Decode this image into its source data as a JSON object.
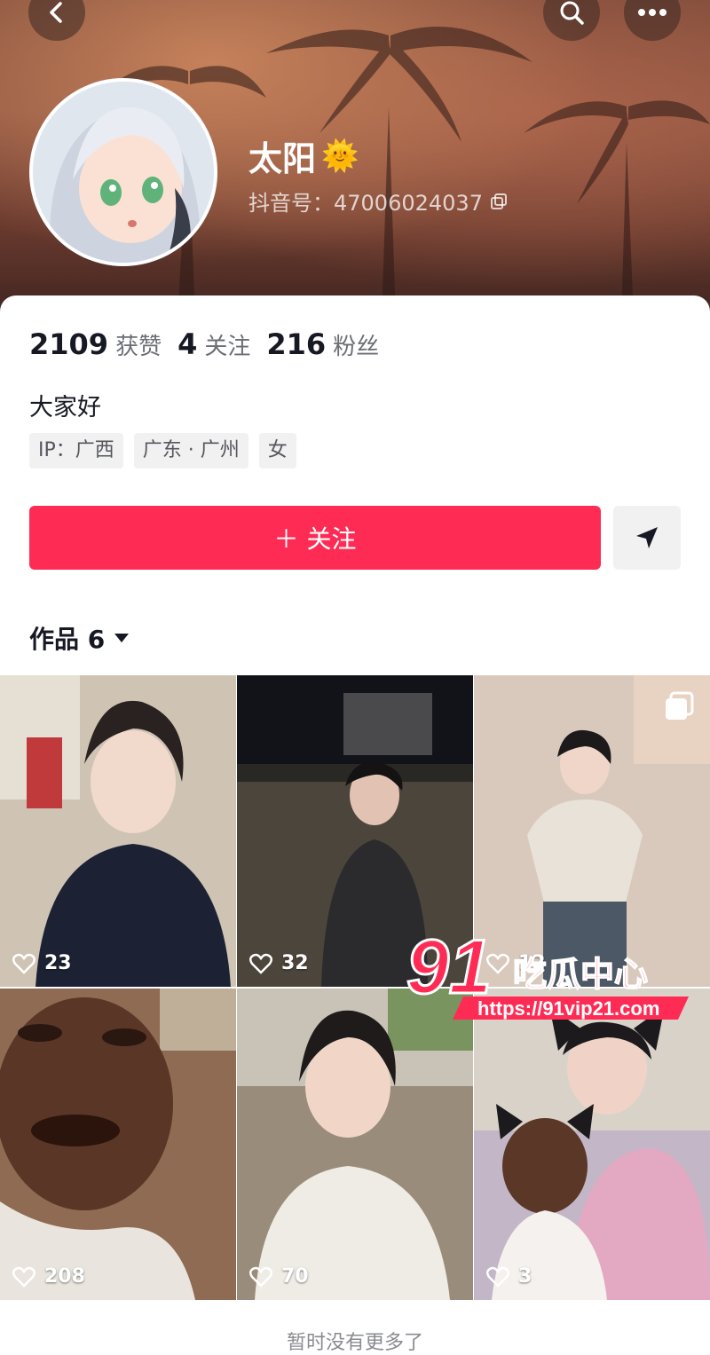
{
  "header": {
    "name": "太阳",
    "name_emoji": "🌞",
    "handle": "抖音号：47006024037"
  },
  "icons": {
    "back": "chevron-left-icon",
    "search": "search-icon",
    "more": "more-dots-icon",
    "copy": "copy-icon",
    "share": "paper-plane-icon",
    "heart": "heart-icon",
    "dropdown": "caret-down-icon",
    "multi": "multi-image-icon"
  },
  "stats": [
    {
      "value": "2109",
      "label": "获赞"
    },
    {
      "value": "4",
      "label": "关注"
    },
    {
      "value": "216",
      "label": "粉丝"
    }
  ],
  "bio": "大家好",
  "tags": [
    "IP：广西",
    "广东 · 广州",
    "女"
  ],
  "follow_label": "＋ 关注",
  "works": {
    "title": "作品 6"
  },
  "videos": [
    {
      "likes": "23",
      "bg": "#cfc4b4"
    },
    {
      "likes": "32",
      "bg": "#2a2824"
    },
    {
      "likes": "12",
      "bg": "#d9c9bd"
    },
    {
      "likes": "208",
      "bg": "#8e6b52"
    },
    {
      "likes": "70",
      "bg": "#9a8c7a"
    },
    {
      "likes": "3",
      "bg": "#c2b6c7"
    }
  ],
  "end_note": "暂时没有更多了",
  "watermark": {
    "brand": "91吃瓜中心",
    "url": "https://91vip21.com"
  },
  "colors": {
    "accent": "#fe2c55",
    "text": "#161823",
    "muted": "#6b6e74"
  }
}
